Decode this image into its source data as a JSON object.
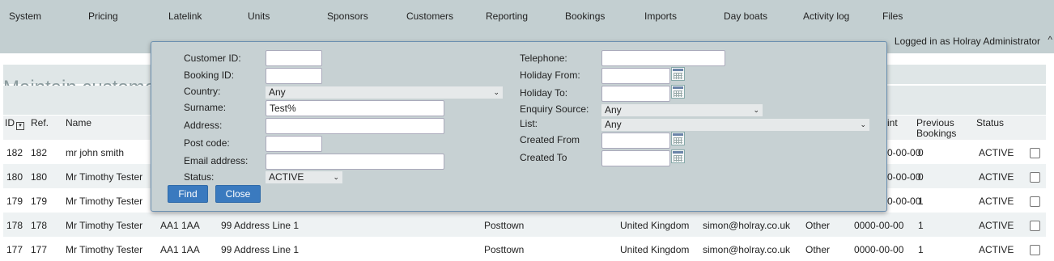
{
  "nav": {
    "items": [
      "System",
      "Pricing",
      "Latelink",
      "Units",
      "Sponsors",
      "Customers",
      "Reporting",
      "Bookings",
      "Imports",
      "Day boats",
      "Activity log",
      "Files"
    ],
    "logged_in": "Logged in as Holray Administrator",
    "scroll_glyph": "^"
  },
  "page": {
    "title": "Maintain custome"
  },
  "table": {
    "headers": {
      "id": "ID",
      "ref": "Ref.",
      "name": "Name",
      "last_col": "int",
      "previous": "Previous Bookings",
      "status": "Status"
    },
    "rows": [
      {
        "id": "182",
        "ref": "182",
        "name": "mr john smith",
        "postcode": "",
        "address": "",
        "town": "",
        "country": "",
        "email": "",
        "source": "",
        "date": "0-00-00",
        "prev": "0",
        "status": "ACTIVE"
      },
      {
        "id": "180",
        "ref": "180",
        "name": "Mr Timothy Tester",
        "postcode": "",
        "address": "",
        "town": "",
        "country": "",
        "email": "",
        "source": "",
        "date": "0-00-00",
        "prev": "0",
        "status": "ACTIVE"
      },
      {
        "id": "179",
        "ref": "179",
        "name": "Mr Timothy Tester",
        "postcode": "",
        "address": "",
        "town": "",
        "country": "",
        "email": "",
        "source": "",
        "date": "0-00-00",
        "prev": "1",
        "status": "ACTIVE"
      },
      {
        "id": "178",
        "ref": "178",
        "name": "Mr Timothy Tester",
        "postcode": "AA1 1AA",
        "address": "99 Address Line 1",
        "town": "Posttown",
        "country": "United Kingdom",
        "email": "simon@holray.co.uk",
        "source": "Other",
        "date": "0000-00-00",
        "prev": "1",
        "status": "ACTIVE"
      },
      {
        "id": "177",
        "ref": "177",
        "name": "Mr Timothy Tester",
        "postcode": "AA1 1AA",
        "address": "99 Address Line 1",
        "town": "Posttown",
        "country": "United Kingdom",
        "email": "simon@holray.co.uk",
        "source": "Other",
        "date": "0000-00-00",
        "prev": "1",
        "status": "ACTIVE"
      }
    ]
  },
  "search": {
    "customer_id": {
      "label": "Customer ID:",
      "value": ""
    },
    "booking_id": {
      "label": "Booking ID:",
      "value": ""
    },
    "country": {
      "label": "Country:",
      "value": "Any"
    },
    "surname": {
      "label": "Surname:",
      "value": "Test%"
    },
    "address": {
      "label": "Address:",
      "value": ""
    },
    "postcode": {
      "label": "Post code:",
      "value": ""
    },
    "email": {
      "label": "Email address:",
      "value": ""
    },
    "status": {
      "label": "Status:",
      "value": "ACTIVE"
    },
    "telephone": {
      "label": "Telephone:",
      "value": ""
    },
    "holiday_from": {
      "label": "Holiday From:",
      "value": ""
    },
    "holiday_to": {
      "label": "Holiday To:",
      "value": ""
    },
    "enquiry_source": {
      "label": "Enquiry Source:",
      "value": "Any"
    },
    "list": {
      "label": "List:",
      "value": "Any"
    },
    "created_from": {
      "label": "Created From",
      "value": ""
    },
    "created_to": {
      "label": "Created To",
      "value": ""
    },
    "find_label": "Find",
    "close_label": "Close",
    "chevron_glyph": "⌄"
  }
}
